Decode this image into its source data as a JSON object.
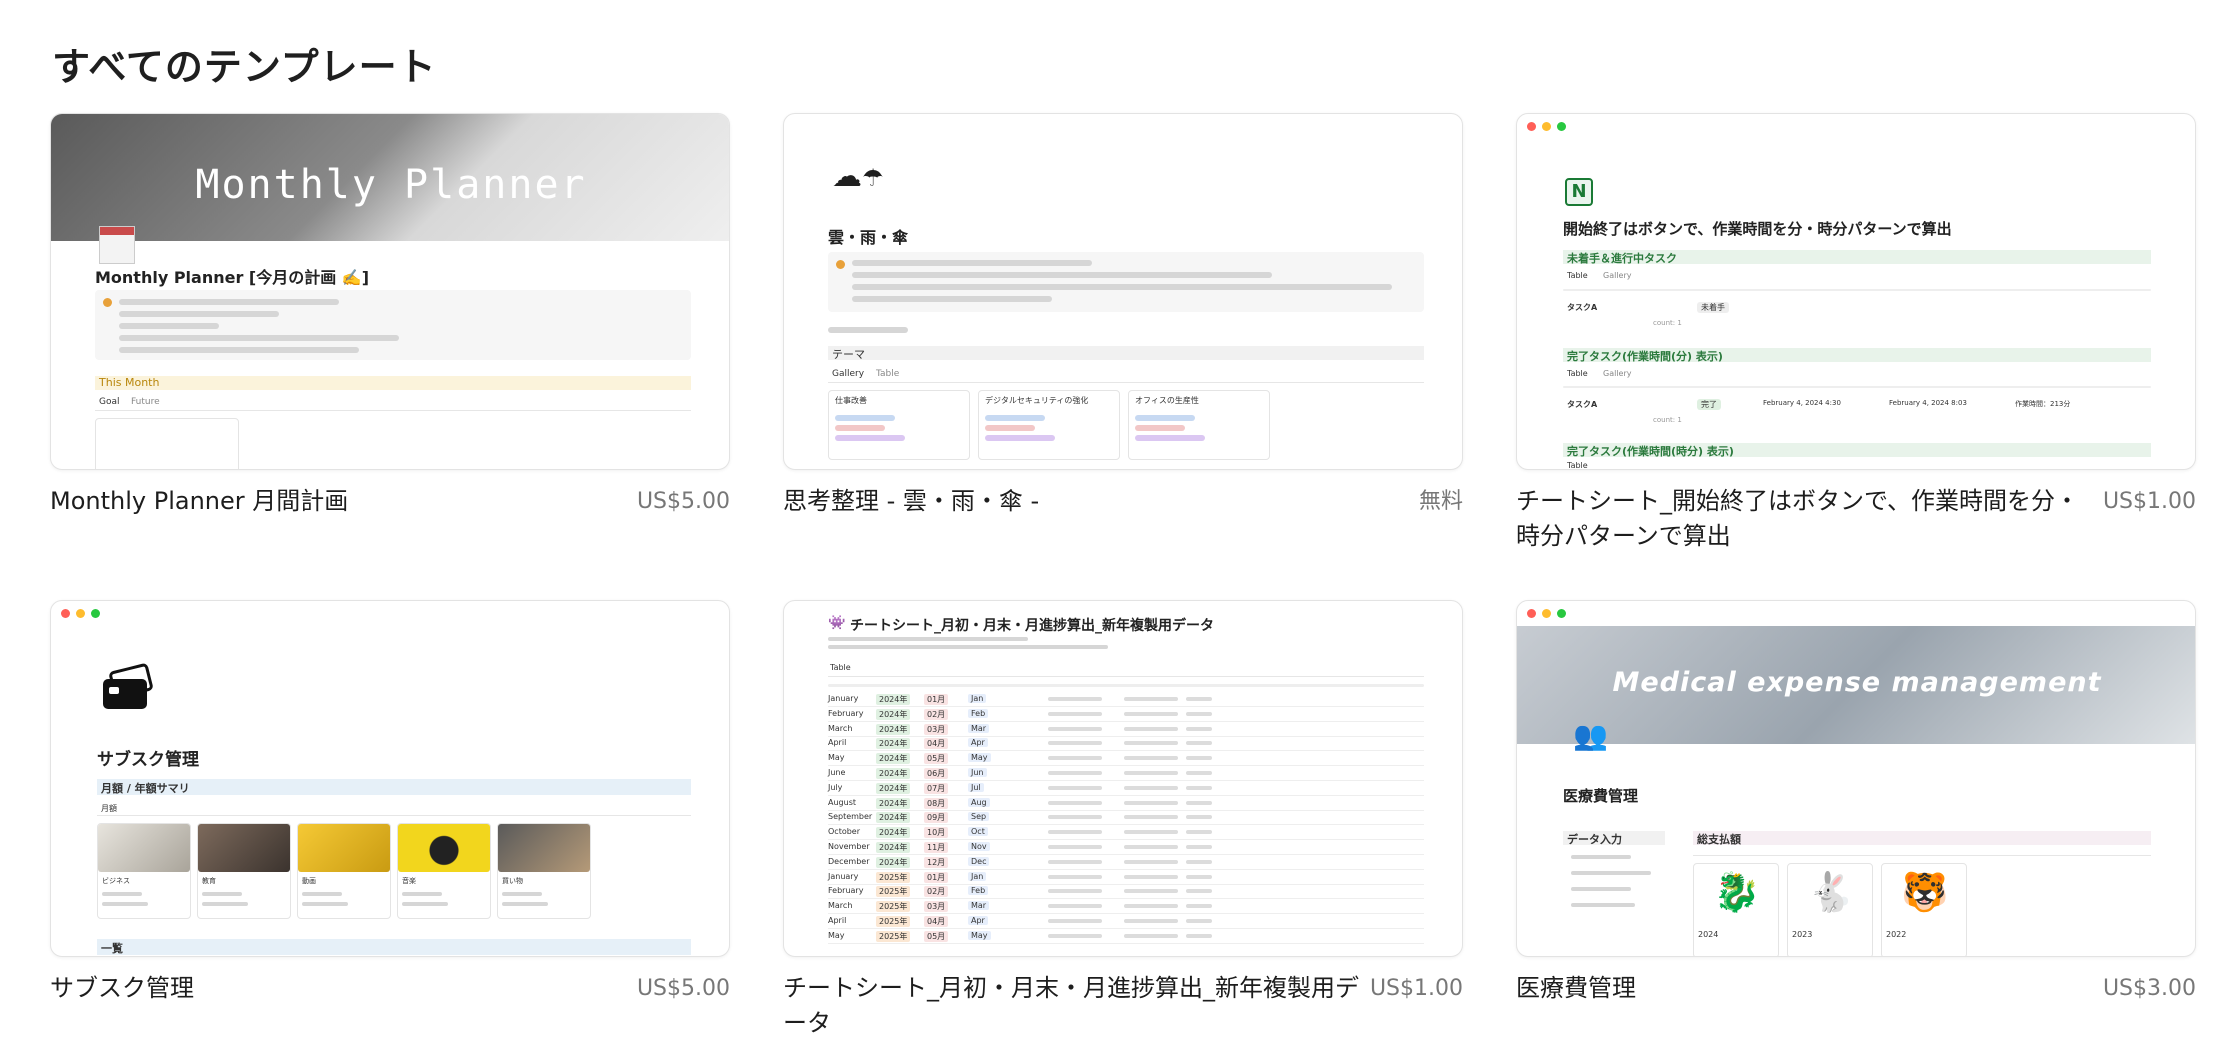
{
  "section_title": "すべてのテンプレート",
  "colors": {
    "accent_green": "#e8f3ea",
    "accent_blue": "#e6f0f8",
    "dot_red": "#ff5f57",
    "dot_yellow": "#febc2e",
    "dot_green": "#28c840"
  },
  "templates": [
    {
      "name": "Monthly Planner 月間計画",
      "price": "US$5.00",
      "thumb": {
        "header": "Monthly Planner",
        "title": "Monthly Planner [今月の計画 ✍️]",
        "section": "This Month",
        "tabs": [
          "Goal",
          "Future"
        ]
      }
    },
    {
      "name": "思考整理 - 雲・雨・傘 -",
      "price": "無料",
      "thumb": {
        "icon": "cloud-rain-umbrella-icon",
        "title": "雲・雨・傘",
        "section": "テーマ",
        "tabs": [
          "Gallery",
          "Table"
        ],
        "tiles": [
          "仕事改善",
          "デジタルセキュリティの強化",
          "オフィスの生産性"
        ]
      }
    },
    {
      "name": "チートシート_開始終了はボタンで、作業時間を分・時分パターンで算出",
      "price": "US$1.00",
      "thumb": {
        "title": "開始終了はボタンで、作業時間を分・時分パターンで算出",
        "sections": [
          "未着手＆進行中タスク",
          "完了タスク(作業時間(分) 表示)",
          "完了タスク(作業時間(時分) 表示)"
        ],
        "tabs": [
          "Table",
          "Gallery"
        ],
        "row_label": "タスクA",
        "status_todo": "未着手",
        "status_done": "完了",
        "count_label": "count: 1",
        "start_time": "February 4, 2024 4:30",
        "end_time": "February 4, 2024 8:03",
        "duration": "作業時間：213分"
      }
    },
    {
      "name": "サブスク管理",
      "price": "US$5.00",
      "thumb": {
        "title": "サブスク管理",
        "section": "月額 / 年額サマリ",
        "tab": "月額",
        "section2": "一覧",
        "categories": [
          "ビジネス",
          "教育",
          "動画",
          "音楽",
          "買い物"
        ]
      }
    },
    {
      "name": "チートシート_月初・月末・月進捗算出_新年複製用データ",
      "price": "US$1.00",
      "thumb": {
        "title": "チートシート_月初・月末・月進捗算出_新年複製用データ",
        "tab": "Table",
        "months": [
          "January",
          "February",
          "March",
          "April",
          "May",
          "June",
          "July",
          "August",
          "September",
          "October",
          "November",
          "December",
          "January",
          "February",
          "March",
          "April",
          "May"
        ],
        "years": [
          "2024年",
          "2024年",
          "2024年",
          "2024年",
          "2024年",
          "2024年",
          "2024年",
          "2024年",
          "2024年",
          "2024年",
          "2024年",
          "2024年",
          "2025年",
          "2025年",
          "2025年",
          "2025年",
          "2025年"
        ],
        "nums": [
          "01月",
          "02月",
          "03月",
          "04月",
          "05月",
          "06月",
          "07月",
          "08月",
          "09月",
          "10月",
          "11月",
          "12月",
          "01月",
          "02月",
          "03月",
          "04月",
          "05月"
        ],
        "abbr": [
          "Jan",
          "Feb",
          "Mar",
          "Apr",
          "May",
          "Jun",
          "Jul",
          "Aug",
          "Sep",
          "Oct",
          "Nov",
          "Dec",
          "Jan",
          "Feb",
          "Mar",
          "Apr",
          "May"
        ]
      }
    },
    {
      "name": "医療費管理",
      "price": "US$3.00",
      "thumb": {
        "banner": "Medical expense management",
        "title": "医療費管理",
        "left_section": "データ入力",
        "right_section": "総支払額",
        "years": [
          "2024",
          "2023",
          "2022"
        ]
      }
    }
  ]
}
